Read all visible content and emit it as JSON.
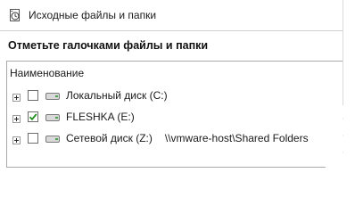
{
  "window": {
    "title": "Исходные файлы и папки",
    "title_icon": "restore-clock-icon"
  },
  "section": {
    "heading": "Отметьте галочками файлы и папки"
  },
  "tree": {
    "column_header": "Наименование",
    "items": [
      {
        "label": "Локальный диск (C:)",
        "checked": false,
        "path": "",
        "icon": "hard-drive-icon"
      },
      {
        "label": "FLESHKA (E:)",
        "checked": true,
        "path": "",
        "icon": "usb-drive-icon"
      },
      {
        "label": "Сетевой диск (Z:)",
        "checked": false,
        "path": "\\\\vmware-host\\Shared Folders",
        "icon": "network-drive-icon"
      }
    ]
  },
  "colors": {
    "checkmark": "#1f8f1f",
    "border": "#a9a9a9"
  }
}
